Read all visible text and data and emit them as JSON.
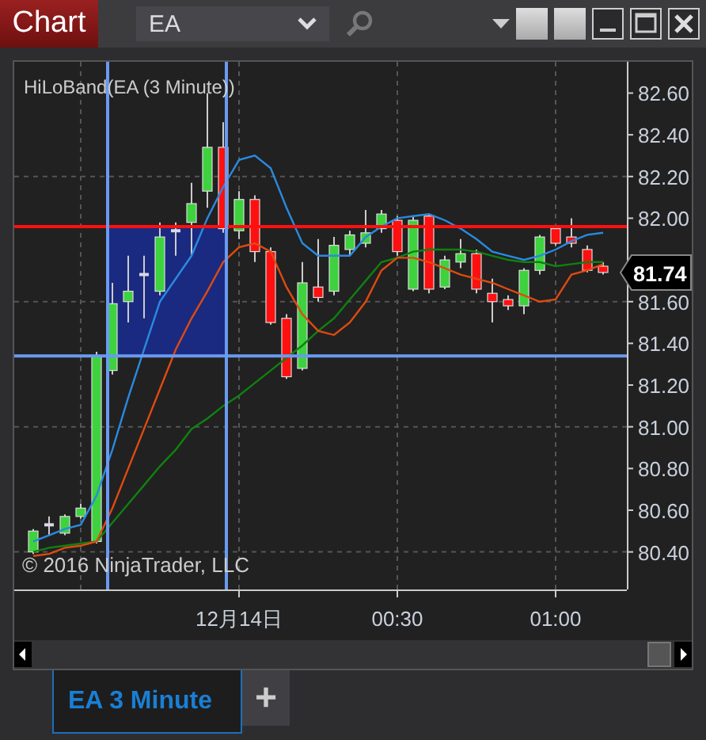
{
  "window": {
    "title": "Chart"
  },
  "instrument_selector": {
    "value": "EA"
  },
  "chart": {
    "indicator_label": "HiLoBand(EA (3 Minute))",
    "copyright": "© 2016 NinjaTrader, LLC",
    "last_price": "81.74",
    "chart_data": {
      "type": "candlestick",
      "grid": true,
      "xlim": [
        -42.6,
        73.5
      ],
      "ylim": [
        80.22,
        82.75
      ],
      "x": [
        -39,
        -36,
        -33,
        -30,
        -27,
        -24,
        -21,
        -18,
        -15,
        -12,
        -9,
        -6,
        -3,
        0,
        3,
        6,
        9,
        12,
        15,
        18,
        21,
        24,
        27,
        30,
        33,
        36,
        39,
        42,
        45,
        48,
        51,
        54,
        57,
        60,
        63,
        66,
        69
      ],
      "xticks": [
        {
          "value": 0,
          "label": "12月14日"
        },
        {
          "value": 30,
          "label": "00:30"
        },
        {
          "value": 60,
          "label": "01:00"
        }
      ],
      "yticks": [
        {
          "value": 82.6,
          "label": "82.60"
        },
        {
          "value": 82.4,
          "label": "82.40"
        },
        {
          "value": 82.2,
          "label": "82.20"
        },
        {
          "value": 82.0,
          "label": "82.00"
        },
        {
          "value": 81.6,
          "label": "81.60"
        },
        {
          "value": 81.4,
          "label": "81.40"
        },
        {
          "value": 81.2,
          "label": "81.20"
        },
        {
          "value": 81.0,
          "label": "81.00"
        },
        {
          "value": 80.8,
          "label": "80.80"
        },
        {
          "value": 80.6,
          "label": "80.60"
        },
        {
          "value": 80.4,
          "label": "80.40"
        }
      ],
      "ohlc": [
        [
          80.4,
          80.51,
          80.39,
          80.5
        ],
        [
          80.53,
          80.57,
          80.48,
          80.53
        ],
        [
          80.49,
          80.58,
          80.48,
          80.57
        ],
        [
          80.57,
          80.63,
          80.56,
          80.61
        ],
        [
          80.45,
          81.36,
          80.44,
          81.34
        ],
        [
          81.27,
          81.69,
          81.25,
          81.59
        ],
        [
          81.6,
          81.82,
          81.5,
          81.65
        ],
        [
          81.73,
          81.82,
          81.52,
          81.73
        ],
        [
          81.65,
          81.98,
          81.63,
          81.91
        ],
        [
          81.94,
          81.98,
          81.82,
          81.94
        ],
        [
          81.98,
          82.17,
          81.82,
          82.07
        ],
        [
          82.13,
          82.6,
          82.05,
          82.34
        ],
        [
          82.34,
          82.46,
          81.93,
          81.95
        ],
        [
          81.94,
          82.13,
          81.9,
          82.09
        ],
        [
          82.09,
          82.11,
          81.79,
          81.84
        ],
        [
          81.84,
          81.86,
          81.49,
          81.5
        ],
        [
          81.52,
          81.54,
          81.23,
          81.24
        ],
        [
          81.28,
          81.79,
          81.27,
          81.69
        ],
        [
          81.67,
          81.9,
          81.6,
          81.62
        ],
        [
          81.65,
          81.91,
          81.63,
          81.87
        ],
        [
          81.85,
          81.94,
          81.82,
          81.92
        ],
        [
          81.88,
          82.04,
          81.86,
          81.93
        ],
        [
          81.95,
          82.04,
          81.93,
          82.02
        ],
        [
          81.99,
          82.01,
          81.82,
          81.84
        ],
        [
          81.66,
          82.01,
          81.65,
          81.99
        ],
        [
          82.01,
          82.02,
          81.64,
          81.66
        ],
        [
          81.67,
          81.82,
          81.66,
          81.8
        ],
        [
          81.79,
          81.9,
          81.76,
          81.83
        ],
        [
          81.83,
          81.85,
          81.64,
          81.66
        ],
        [
          81.64,
          81.71,
          81.5,
          81.6
        ],
        [
          81.61,
          81.63,
          81.56,
          81.58
        ],
        [
          81.58,
          81.76,
          81.54,
          81.75
        ],
        [
          81.75,
          81.92,
          81.73,
          81.91
        ],
        [
          81.95,
          81.96,
          81.87,
          81.88
        ],
        [
          81.91,
          82.0,
          81.86,
          81.88
        ],
        [
          81.85,
          81.87,
          81.74,
          81.75
        ],
        [
          81.77,
          81.79,
          81.73,
          81.74
        ]
      ],
      "series": [
        {
          "type": "line",
          "color": "#108010",
          "values": [
            80.4,
            80.42,
            80.43,
            80.44,
            80.45,
            80.54,
            80.63,
            80.72,
            80.81,
            80.89,
            80.99,
            81.04,
            81.1,
            81.15,
            81.21,
            81.27,
            81.33,
            81.39,
            81.46,
            81.52,
            81.61,
            81.7,
            81.79,
            81.81,
            81.84,
            81.85,
            81.85,
            81.85,
            81.84,
            81.82,
            81.8,
            81.79,
            81.79,
            81.77,
            81.78,
            81.79,
            81.79
          ]
        },
        {
          "type": "line",
          "color": "#e04a10",
          "values": [
            80.38,
            80.39,
            80.42,
            80.43,
            80.45,
            80.61,
            80.8,
            80.99,
            81.18,
            81.37,
            81.52,
            81.65,
            81.79,
            81.86,
            81.88,
            81.84,
            81.67,
            81.54,
            81.46,
            81.44,
            81.5,
            81.6,
            81.75,
            81.81,
            81.81,
            81.79,
            81.76,
            81.73,
            81.71,
            81.69,
            81.66,
            81.63,
            81.6,
            81.61,
            81.73,
            81.75,
            81.78
          ]
        },
        {
          "type": "line",
          "color": "#2a8ae0",
          "values": [
            80.45,
            80.48,
            80.51,
            80.53,
            80.67,
            80.89,
            81.14,
            81.37,
            81.6,
            81.71,
            81.82,
            82.0,
            82.15,
            82.28,
            82.3,
            82.24,
            82.05,
            81.88,
            81.82,
            81.82,
            81.82,
            81.91,
            81.96,
            82.0,
            82.01,
            82.02,
            81.99,
            81.95,
            81.9,
            81.84,
            81.82,
            81.8,
            81.82,
            81.85,
            81.89,
            81.92,
            81.93
          ]
        }
      ],
      "bands": [
        {
          "axis": "x",
          "from": -24.9,
          "to": -2.4,
          "color": "#1a2a80"
        }
      ],
      "ref_lines": [
        {
          "axis": "y",
          "value": 81.96,
          "color": "#ff1010"
        },
        {
          "axis": "y",
          "value": 81.34,
          "color": "#6a9af0"
        },
        {
          "axis": "x",
          "value": -24.9,
          "color": "#6a9af0"
        },
        {
          "axis": "x",
          "value": -2.4,
          "color": "#6a9af0"
        }
      ]
    }
  },
  "tabs": [
    {
      "label": "EA 3 Minute",
      "selected": true
    }
  ],
  "add_tab": "+"
}
